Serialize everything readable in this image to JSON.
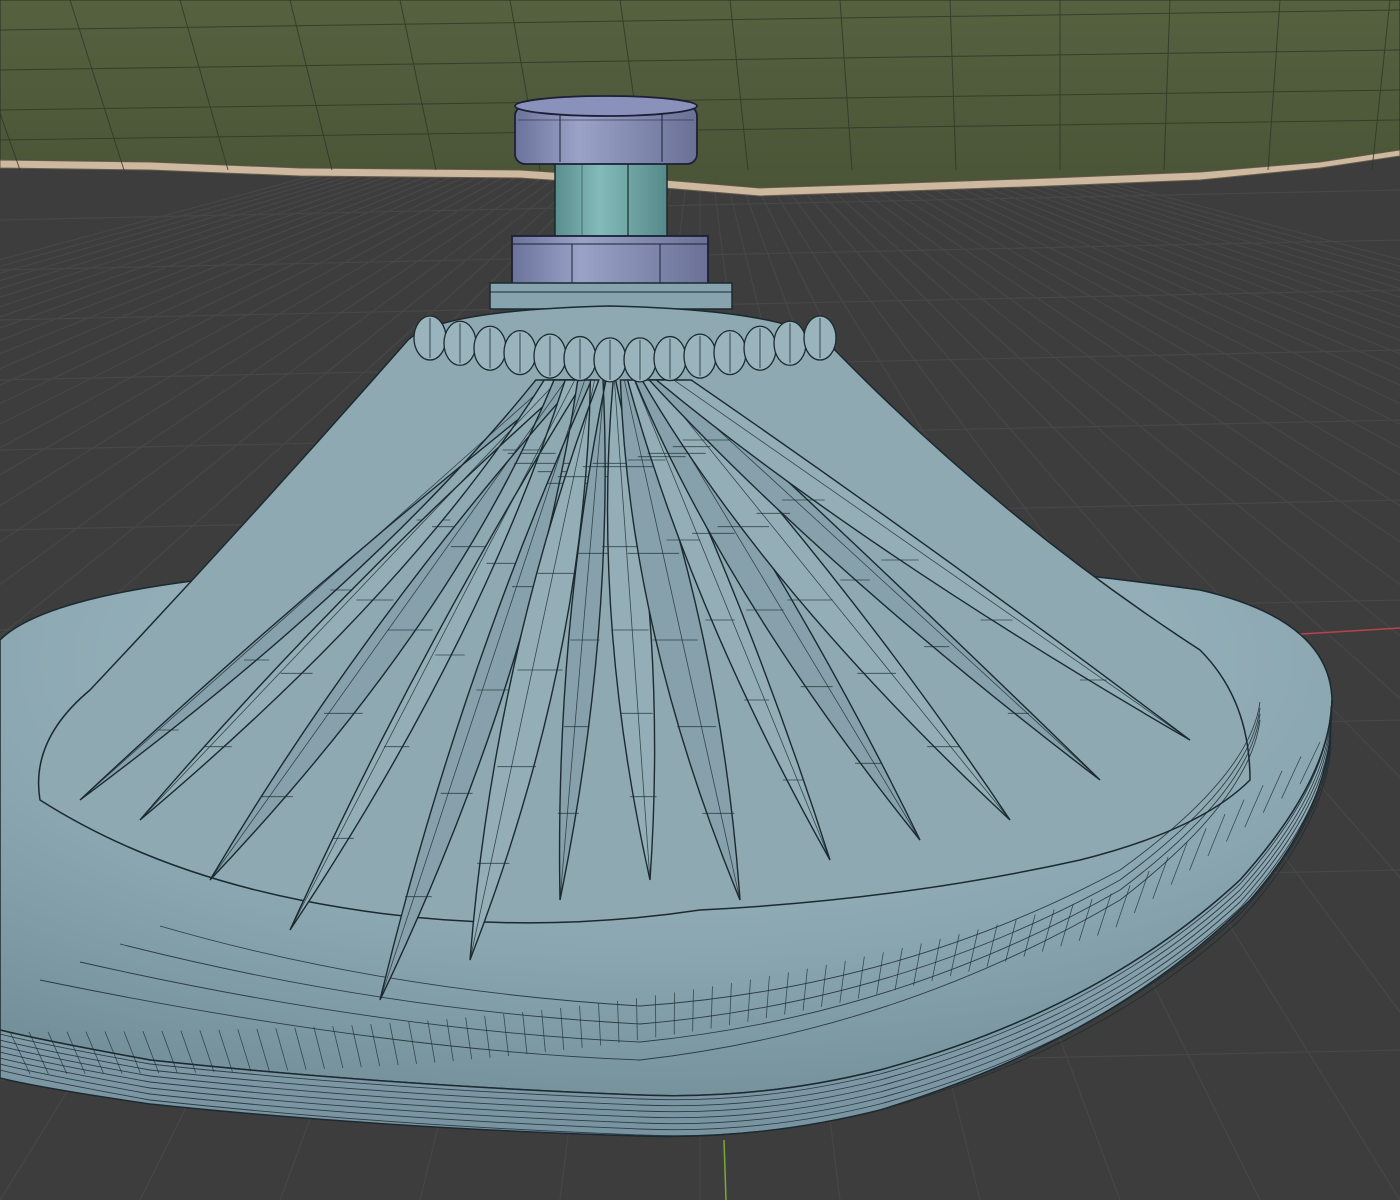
{
  "viewport": {
    "kind": "3d-viewport",
    "shading": "solid",
    "overlay": "wireframe",
    "background_color": "#3d3d3d",
    "grid_line_color": "#474747",
    "x_axis_color": "#b5434d",
    "y_axis_color": "#7ea63a"
  },
  "scene": {
    "objects": [
      {
        "name": "table-top",
        "color": "#4e5a3a",
        "edge_color": "#cdb9a0"
      },
      {
        "name": "upper-collar",
        "color": "#8890b8"
      },
      {
        "name": "column",
        "color": "#6ea6a6"
      },
      {
        "name": "lower-collar",
        "color": "#8890b8"
      },
      {
        "name": "pedestal-base",
        "color": "#7f9ea8",
        "ornament": "carved-leaves"
      }
    ]
  }
}
